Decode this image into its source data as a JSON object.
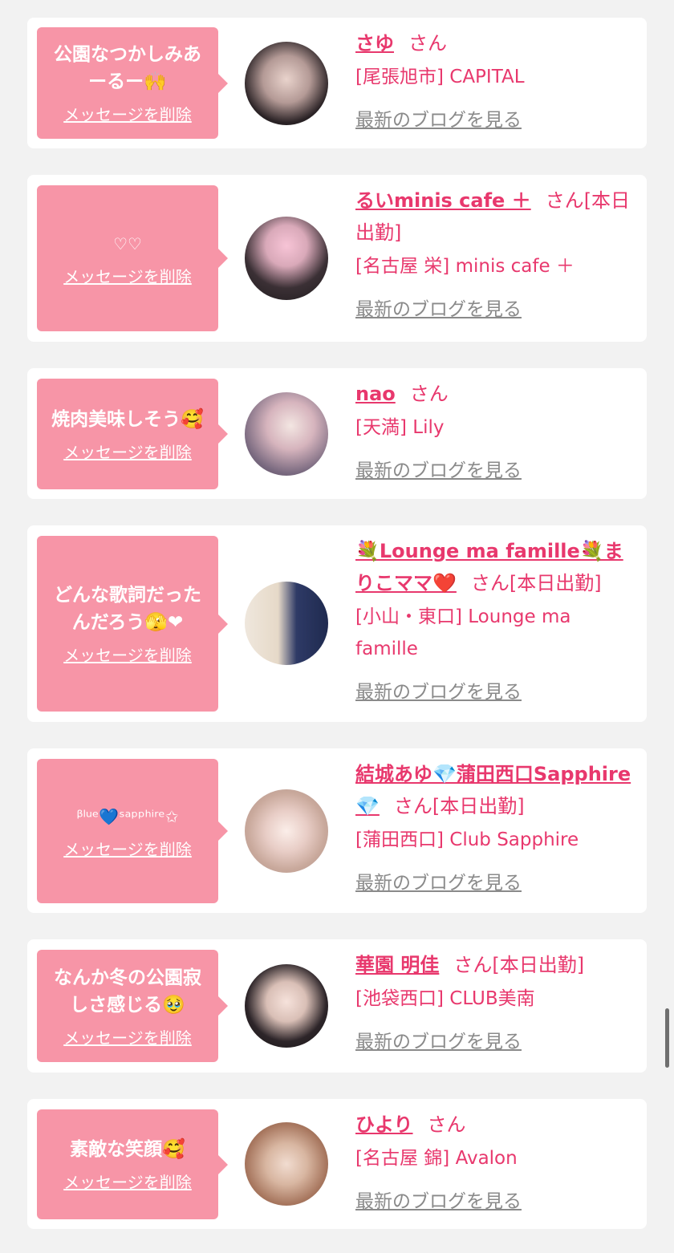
{
  "delete_label": "メッセージを削除",
  "blog_label": "最新のブログを見る",
  "san": "さん",
  "cards": [
    {
      "message": "公園なつかしみあーるー🙌",
      "name": "さゆ",
      "suffix": "",
      "shop": "[尾張旭市] CAPITAL"
    },
    {
      "message": "♡♡",
      "name": "るいminis cafe ＋",
      "suffix": "[本日出勤]",
      "shop": "[名古屋 栄] minis cafe ＋"
    },
    {
      "message": "焼肉美味しそう🥰",
      "name": "nao",
      "suffix": "",
      "shop": "[天満] Lily"
    },
    {
      "message": "どんな歌詞だったんだろう🫣❤",
      "name": "💐Lounge ma famille💐まりこママ❤️",
      "suffix": "[本日出勤]",
      "shop": "[小山・東口] Lounge ma famille"
    },
    {
      "message": "ᵝˡᵘᵉ💙ˢᵃᵖᵖʰⁱʳᵉ✩",
      "name": "結城あゆ💎蒲田西口Sapphire💎",
      "suffix": "[本日出勤]",
      "shop": "[蒲田西口] Club Sapphire"
    },
    {
      "message": "なんか冬の公園寂しさ感じる🥹",
      "name": "華園 明佳",
      "suffix": "[本日出勤]",
      "shop": "[池袋西口] CLUB美南"
    },
    {
      "message": "素敵な笑顔🥰",
      "name": "ひより",
      "suffix": "",
      "shop": "[名古屋 錦] Avalon"
    }
  ]
}
